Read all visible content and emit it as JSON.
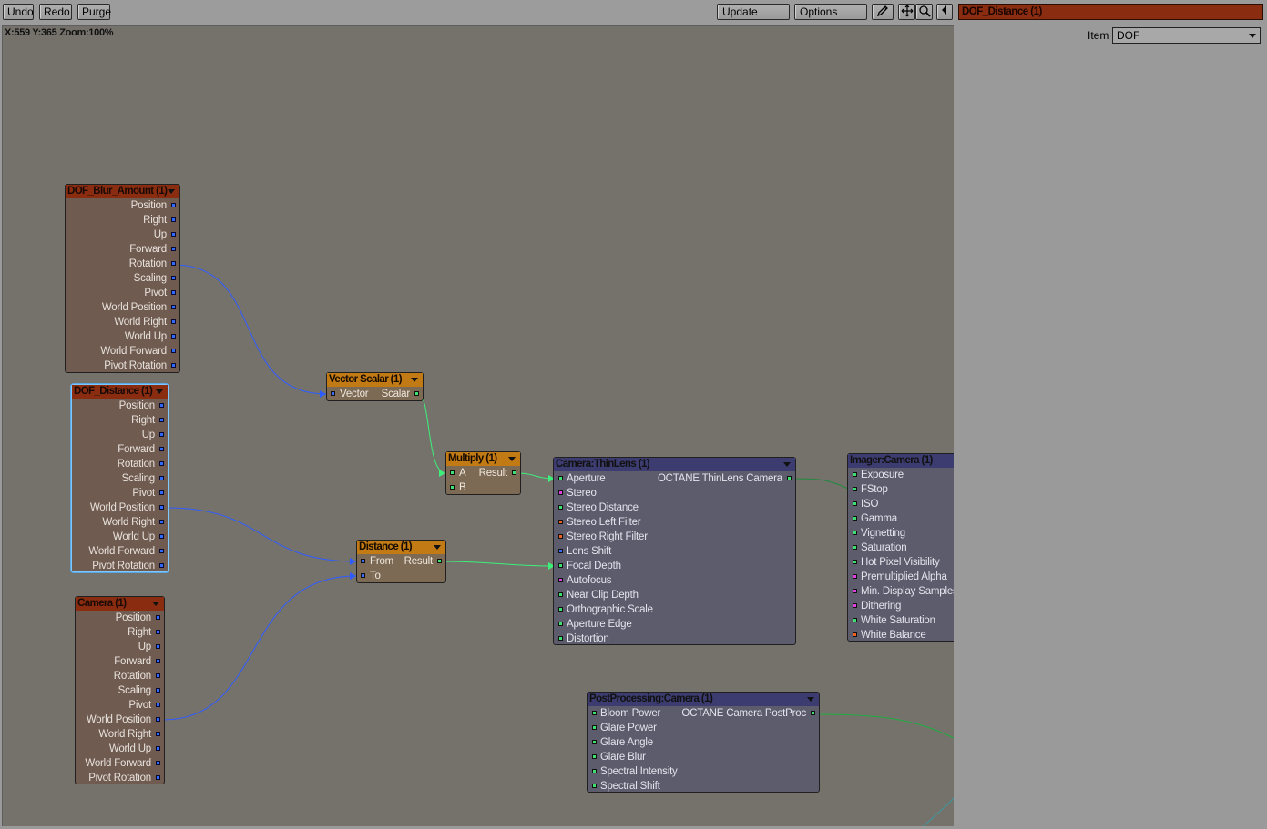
{
  "toolbar": {
    "undo": "Undo",
    "redo": "Redo",
    "purge": "Purge",
    "update": "Update",
    "options": "Options"
  },
  "status": {
    "coords": "X:559 Y:365 Zoom:100%"
  },
  "panel": {
    "title": "DOF_Distance (1)",
    "item_label": "Item",
    "item_value": "DOF"
  },
  "nodes": {
    "blur": {
      "title": "DOF_Blur_Amount (1)",
      "outputs": [
        "Position",
        "Right",
        "Up",
        "Forward",
        "Rotation",
        "Scaling",
        "Pivot",
        "World Position",
        "World Right",
        "World Up",
        "World Forward",
        "Pivot Rotation"
      ]
    },
    "dist_item": {
      "title": "DOF_Distance (1)",
      "outputs": [
        "Position",
        "Right",
        "Up",
        "Forward",
        "Rotation",
        "Scaling",
        "Pivot",
        "World Position",
        "World Right",
        "World Up",
        "World Forward",
        "Pivot Rotation"
      ]
    },
    "camera": {
      "title": "Camera (1)",
      "outputs": [
        "Position",
        "Right",
        "Up",
        "Forward",
        "Rotation",
        "Scaling",
        "Pivot",
        "World Position",
        "World Right",
        "World Up",
        "World Forward",
        "Pivot Rotation"
      ]
    },
    "vector_scalar": {
      "title": "Vector Scalar (1)",
      "in": "Vector",
      "out": "Scalar"
    },
    "multiply": {
      "title": "Multiply (1)",
      "in_a": "A",
      "in_b": "B",
      "out": "Result"
    },
    "distance": {
      "title": "Distance (1)",
      "in_from": "From",
      "in_to": "To",
      "out": "Result"
    },
    "thinlens": {
      "title": "Camera:ThinLens (1)",
      "output": "OCTANE ThinLens Camera",
      "inputs": [
        "Aperture",
        "Stereo",
        "Stereo Distance",
        "Stereo Left Filter",
        "Stereo Right Filter",
        "Lens Shift",
        "Focal Depth",
        "Autofocus",
        "Near Clip Depth",
        "Orthographic Scale",
        "Aperture Edge",
        "Distortion"
      ]
    },
    "imager": {
      "title": "Imager:Camera (1)",
      "inputs": [
        "Exposure",
        "FStop",
        "ISO",
        "Gamma",
        "Vignetting",
        "Saturation",
        "Hot Pixel Visibility",
        "Premultiplied Alpha",
        "Min. Display Samples",
        "Dithering",
        "White Saturation",
        "White Balance"
      ]
    },
    "postproc": {
      "title": "PostProcessing:Camera (1)",
      "output": "OCTANE Camera PostProc",
      "inputs": [
        "Bloom Power",
        "Glare Power",
        "Glare Angle",
        "Glare Blur",
        "Spectral Intensity",
        "Spectral Shift"
      ]
    }
  },
  "colors": {
    "wire_blue": "#2f5cff",
    "wire_green": "#3cf07a",
    "item_header": "#8a2c10",
    "math_header": "#c27a14",
    "octane_header": "#3c3c70"
  }
}
